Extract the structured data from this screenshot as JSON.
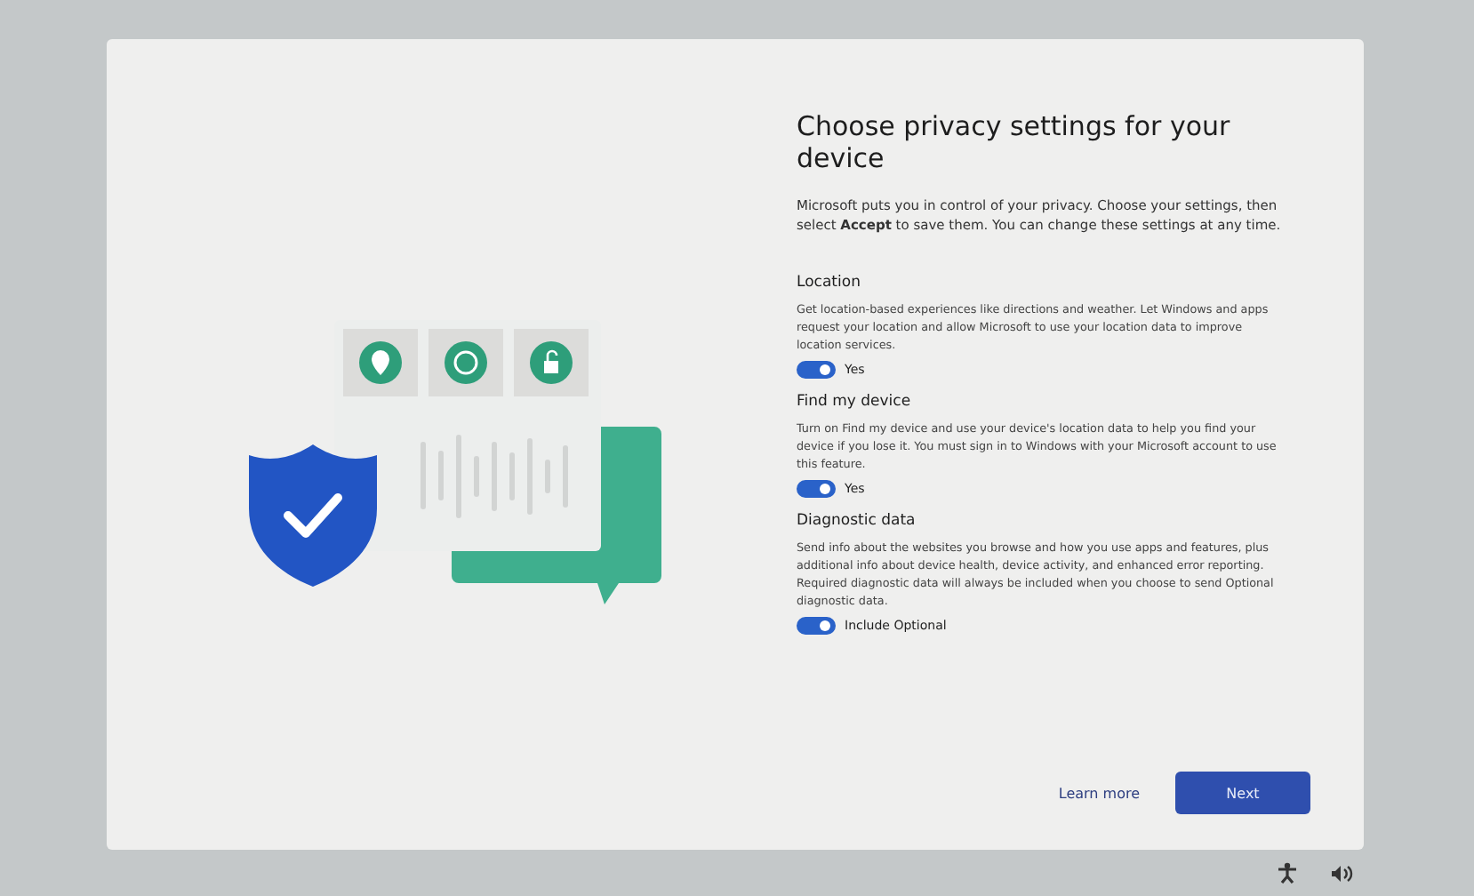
{
  "dialog": {
    "title": "Choose privacy settings for your device",
    "intro": "Microsoft puts you in control of your privacy. Choose your settings, then select **Accept** to save them. You can change these settings at any time.",
    "settings": [
      {
        "heading": "Location",
        "description": "Get location-based experiences like directions and weather. Let Windows and apps request your location and allow Microsoft to use your location data to improve location services.",
        "on": true,
        "toggle_label": "Yes"
      },
      {
        "heading": "Find my device",
        "description": "Turn on Find my device and use your device's location data to help you find your device if you lose it. You must sign in to Windows with your Microsoft account to use this feature.",
        "on": true,
        "toggle_label": "Yes"
      },
      {
        "heading": "Diagnostic data",
        "description": "Send info about the websites you browse and how you use apps and features, plus additional info about device health, device activity, and enhanced error reporting. Required diagnostic data will always be included when you choose to send Optional diagnostic data.",
        "on": true,
        "toggle_label": "Include Optional"
      }
    ],
    "learn_more": "Learn more",
    "next_button": "Next"
  }
}
